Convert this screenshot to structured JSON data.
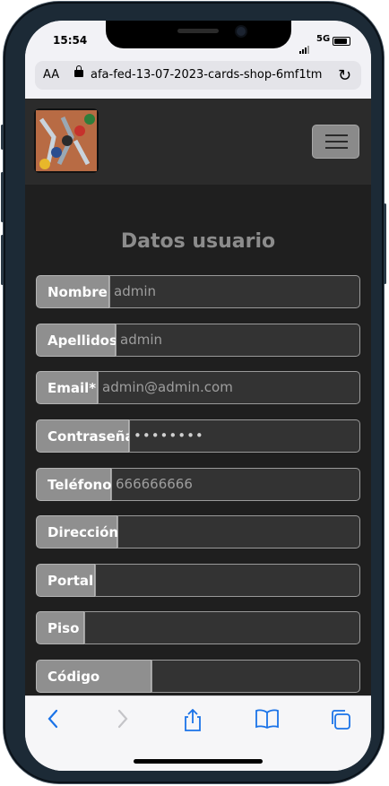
{
  "status_bar": {
    "time": "15:54",
    "network": "5G"
  },
  "browser": {
    "aa_label": "AA",
    "url": "afa-fed-13-07-2023-cards-shop-6mf1tm"
  },
  "page": {
    "heading": "Datos usuario",
    "fields": [
      {
        "label": "Nombre",
        "value": "admin",
        "placeholder": ""
      },
      {
        "label": "Apellidos",
        "value": "admin",
        "placeholder": ""
      },
      {
        "label": "Email*",
        "value": "admin@admin.com",
        "placeholder": ""
      },
      {
        "label": "Contraseña",
        "value": "••••••••",
        "placeholder": ""
      },
      {
        "label": "Teléfono",
        "value": "666666666",
        "placeholder": ""
      },
      {
        "label": "Dirección",
        "value": "",
        "placeholder": ""
      },
      {
        "label": "Portal",
        "value": "",
        "placeholder": ""
      },
      {
        "label": "Piso",
        "value": "",
        "placeholder": ""
      },
      {
        "label": "Código postal*",
        "value": "",
        "placeholder": ""
      }
    ]
  },
  "toolbar": {
    "icons": [
      "back-icon",
      "forward-icon",
      "share-icon",
      "bookmarks-icon",
      "tabs-icon"
    ]
  },
  "colors": {
    "navbar": "#2b2b2b",
    "page_bg": "#1f1f1f",
    "label_bg": "#8f8f8f",
    "input_bg": "#333333",
    "heading": "#8c8c8c",
    "accent_blue": "#1a73e8"
  }
}
